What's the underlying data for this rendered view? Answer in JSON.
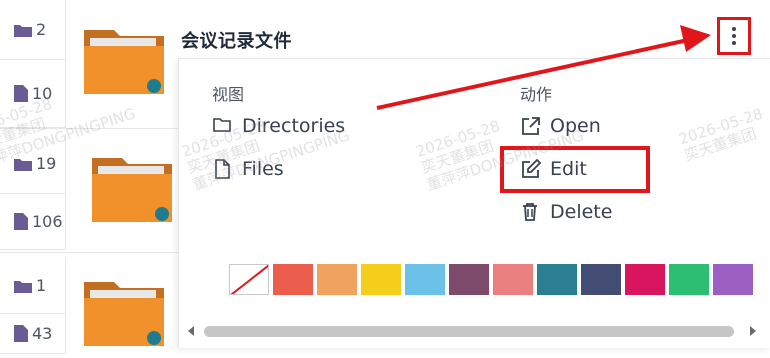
{
  "card": {
    "title": "会议记录文件"
  },
  "folders": [
    {
      "dir_count": "2",
      "file_count": "10"
    },
    {
      "dir_count": "19",
      "file_count": "106"
    },
    {
      "dir_count": "1",
      "file_count": "43"
    }
  ],
  "menu": {
    "view_title": "视图",
    "action_title": "动作",
    "directories_label": "Directories",
    "files_label": "Files",
    "open_label": "Open",
    "edit_label": "Edit",
    "delete_label": "Delete"
  },
  "swatches": [
    "none",
    "#eb5e4e",
    "#f0a35e",
    "#f5cd1b",
    "#6bc1e8",
    "#7d4a6b",
    "#ea7f7f",
    "#2a7f93",
    "#434c72",
    "#d81660",
    "#2dbe74",
    "#9b60c2"
  ],
  "watermark": {
    "date": "2026-05-28",
    "org": "奕天董集团",
    "name": "董萍萍DONGPINGPING"
  },
  "colors": {
    "highlight": "#e1161b",
    "folder": "#f0912c"
  }
}
